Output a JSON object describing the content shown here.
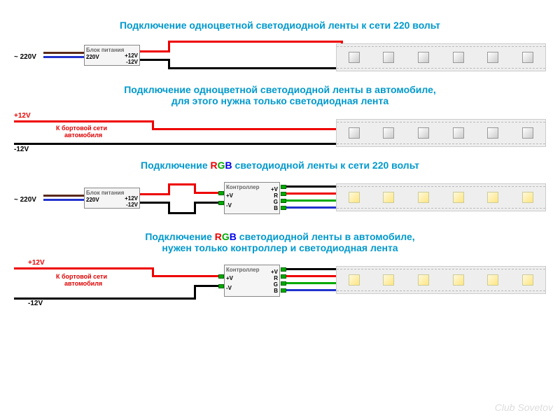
{
  "titles": {
    "t1": "Подключение одноцветной светодиодной ленты к сети 220 вольт",
    "t2a": "Подключение одноцветной светодиодной ленты в автомобиле,",
    "t2b": "для этого нужна только светодиодная лента",
    "t3": "Подключение ",
    "t3_rgb_r": "R",
    "t3_rgb_g": "G",
    "t3_rgb_b": "B",
    "t3_rest": " светодиодной ленты к сети 220 вольт",
    "t4a": "Подключение ",
    "t4_rgb_r": "R",
    "t4_rgb_g": "G",
    "t4_rgb_b": "B",
    "t4a_rest": " светодиодной ленты в автомобиле,",
    "t4b": "нужен только контроллер и светодиодная лента"
  },
  "labels": {
    "v220": "~ 220V",
    "psu": "Блок питания",
    "psu_in": "220V",
    "p12": "+12V",
    "m12": "-12V",
    "car": "К бортовой сети",
    "car2": "автомобиля",
    "ctrl": "Контроллер",
    "pV": "+V",
    "mV": "-V",
    "oV": "+V",
    "oR": "R",
    "oG": "G",
    "oB": "B"
  },
  "watermark": "Club Sovetov"
}
